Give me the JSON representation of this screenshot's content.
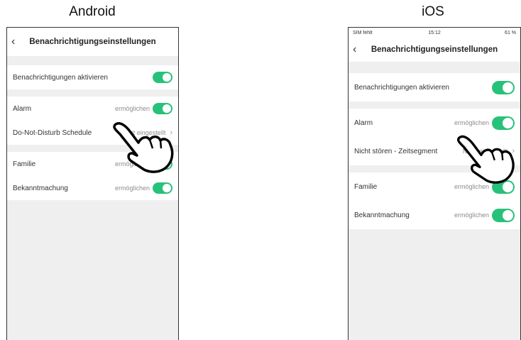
{
  "android": {
    "platform_label": "Android",
    "header": {
      "title": "Benachrichtigungseinstellungen"
    },
    "rows": [
      {
        "label": "Benachrichtigungen aktivieren"
      },
      {
        "label": "Alarm",
        "value": "ermöglichen"
      },
      {
        "label": "Do-Not-Disturb Schedule",
        "value": "Nicht eingestellt"
      },
      {
        "label": "Familie",
        "value": "ermöglichen"
      },
      {
        "label": "Bekanntmachung",
        "value": "ermöglichen"
      }
    ]
  },
  "ios": {
    "platform_label": "iOS",
    "status_bar": {
      "carrier": "SIM fehlt",
      "time": "15:12",
      "battery": "61 %"
    },
    "header": {
      "title": "Benachrichtigungseinstellungen"
    },
    "rows": [
      {
        "label": "Benachrichtigungen aktivieren"
      },
      {
        "label": "Alarm",
        "value": "ermöglichen"
      },
      {
        "label": "Nicht stören - Zeitsegment",
        "value": "Nicht eingestellt"
      },
      {
        "label": "Familie",
        "value": "ermöglichen"
      },
      {
        "label": "Bekanntmachung",
        "value": "ermöglichen"
      }
    ]
  },
  "colors": {
    "toggle_on": "#27c27a",
    "background": "#efefef"
  },
  "icons": {
    "back": "chevron-left-icon",
    "pointer": "hand-pointer-icon"
  }
}
